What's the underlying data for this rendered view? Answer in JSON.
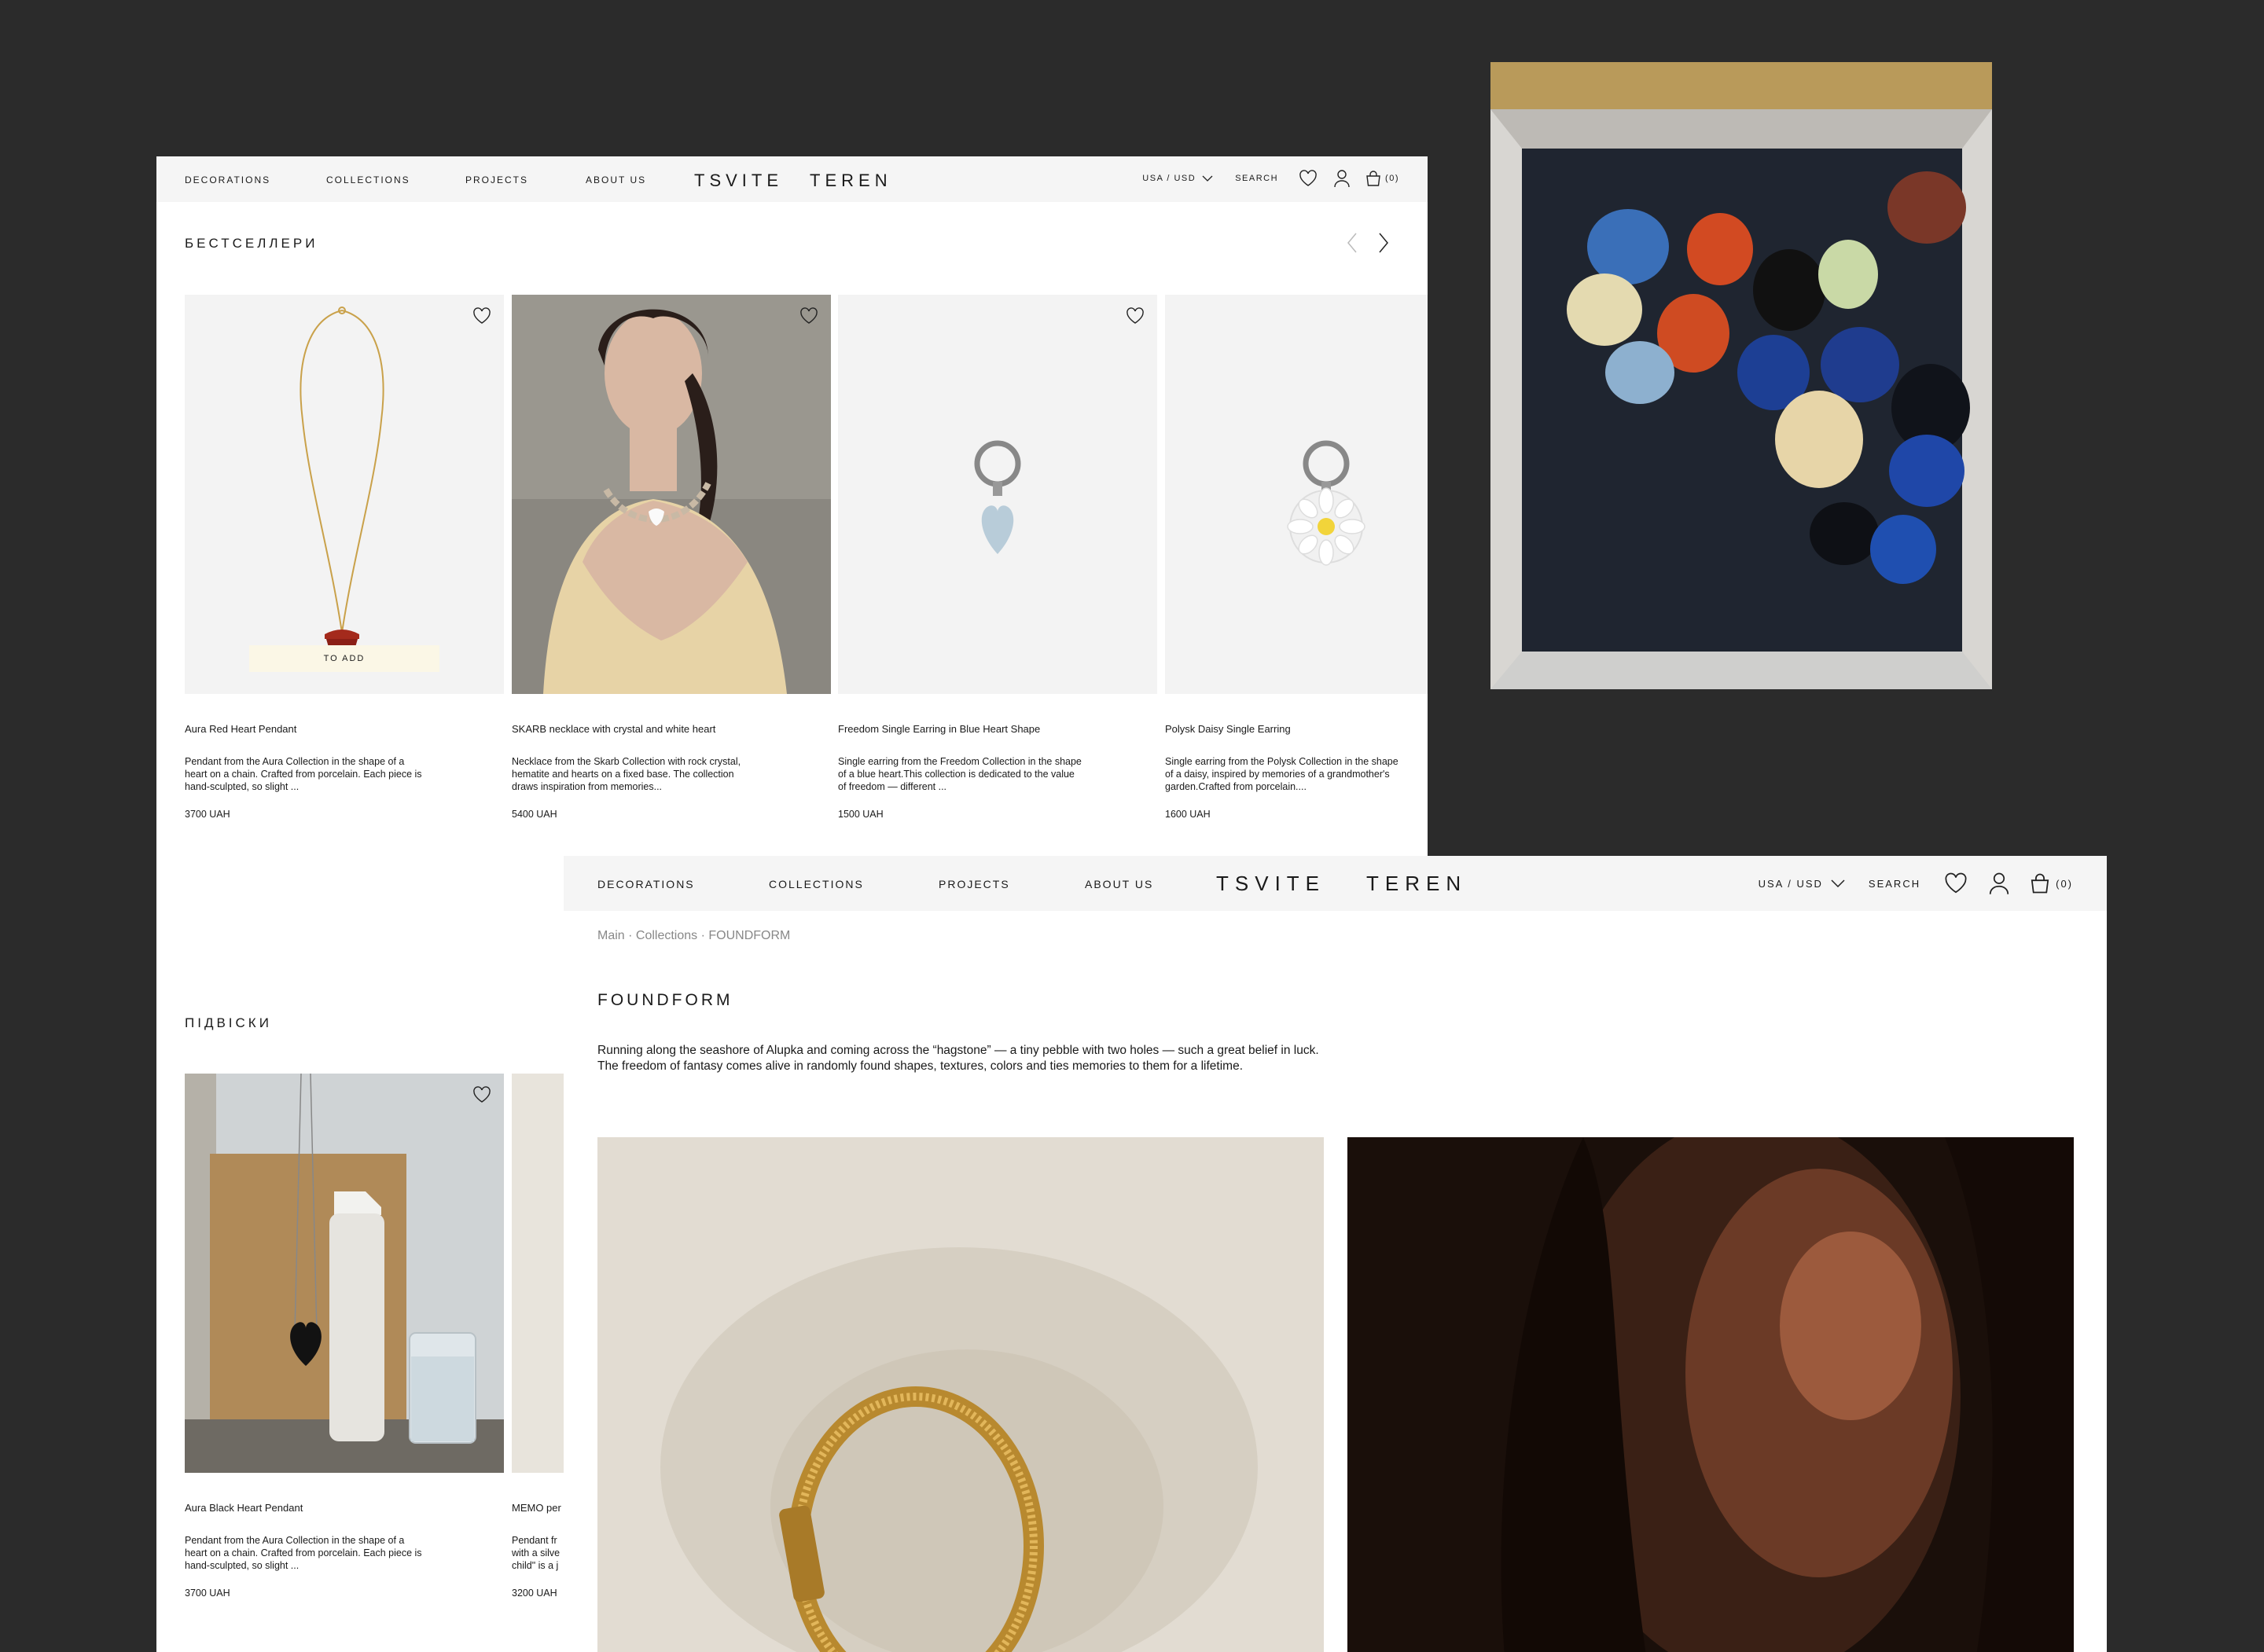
{
  "brand": {
    "logo_a": "TSVITE",
    "logo_b": "TEREN"
  },
  "nav": {
    "items": [
      "DECORATIONS",
      "COLLECTIONS",
      "PROJECTS",
      "ABOUT US"
    ],
    "region": "USA / USD",
    "search": "SEARCH",
    "cart_count": "(0)"
  },
  "bestsellers": {
    "title": "БЕСТСЕЛЛЕРИ",
    "products": [
      {
        "name": "Aura Red Heart Pendant",
        "desc": "Pendant from the Aura Collection in the shape of a heart on a chain. Crafted from porcelain. Each piece is hand-sculpted, so slight ...",
        "price": "3700 UAH",
        "add_label": "TO ADD"
      },
      {
        "name": "SKARB necklace with crystal and white heart",
        "desc": "Necklace from the Skarb Collection with rock crystal, hematite and hearts on a fixed base. The collection draws inspiration from memories...",
        "price": "5400 UAH"
      },
      {
        "name": "Freedom Single Earring in Blue Heart Shape",
        "desc": "Single earring from the Freedom Collection in the shape of a blue heart.This collection is dedicated to the value of freedom — different ...",
        "price": "1500 UAH"
      },
      {
        "name": "Polysk Daisy Single Earring",
        "desc": "Single earring from the Polysk Collection in the shape of a daisy, inspired by memories of a grandmother's garden.Crafted from porcelain....",
        "price": "1600 UAH"
      }
    ]
  },
  "pendants": {
    "title": "ПІДВІСКИ",
    "products": [
      {
        "name": "Aura Black Heart Pendant",
        "desc": "Pendant from the Aura Collection in the shape of a heart on a chain. Crafted from porcelain. Each piece is hand-sculpted, so slight ...",
        "price": "3700 UAH"
      },
      {
        "name": "MEMO per",
        "desc": "Pendant fr with a silve child\" is a j",
        "price": "3200 UAH"
      }
    ]
  },
  "collection": {
    "breadcrumb": "Main · Collections · FOUNDFORM",
    "title": "FOUNDFORM",
    "intro": "Running along the seashore of Alupka and coming across the “hagstone” — a tiny pebble with two holes — such a great belief in luck. The freedom of fantasy comes alive in randomly found shapes, textures, colors and ties memories to them for a lifetime."
  }
}
